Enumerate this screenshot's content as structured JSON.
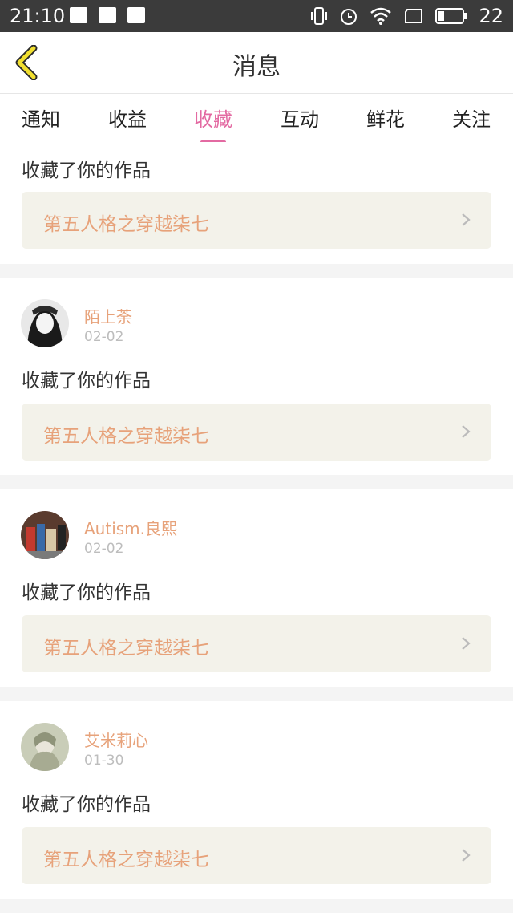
{
  "status_bar": {
    "time": "21:10",
    "battery": "22"
  },
  "header": {
    "title": "消息"
  },
  "tabs": [
    {
      "label": "通知"
    },
    {
      "label": "收益"
    },
    {
      "label": "收藏",
      "active": true
    },
    {
      "label": "互动"
    },
    {
      "label": "鲜花"
    },
    {
      "label": "关注"
    }
  ],
  "items": [
    {
      "action": "收藏了你的作品",
      "work_title": "第五人格之穿越柒七"
    },
    {
      "username": "陌上荼",
      "date": "02-02",
      "action": "收藏了你的作品",
      "work_title": "第五人格之穿越柒七"
    },
    {
      "username": "Autism.良熙",
      "date": "02-02",
      "action": "收藏了你的作品",
      "work_title": "第五人格之穿越柒七"
    },
    {
      "username": "艾米莉心",
      "date": "01-30",
      "action": "收藏了你的作品",
      "work_title": "第五人格之穿越柒七"
    }
  ],
  "colors": {
    "accent_pink": "#e36aa2",
    "username_orange": "#e7a27a",
    "back_arrow_yellow": "#f1df2f",
    "work_bg": "#f3f2ea"
  },
  "icons": [
    "upload-icon",
    "image-icon",
    "sim-icon",
    "vibrate-icon",
    "alarm-icon",
    "wifi-icon",
    "screen-icon",
    "battery-icon",
    "back-icon",
    "chevron-right-icon"
  ]
}
